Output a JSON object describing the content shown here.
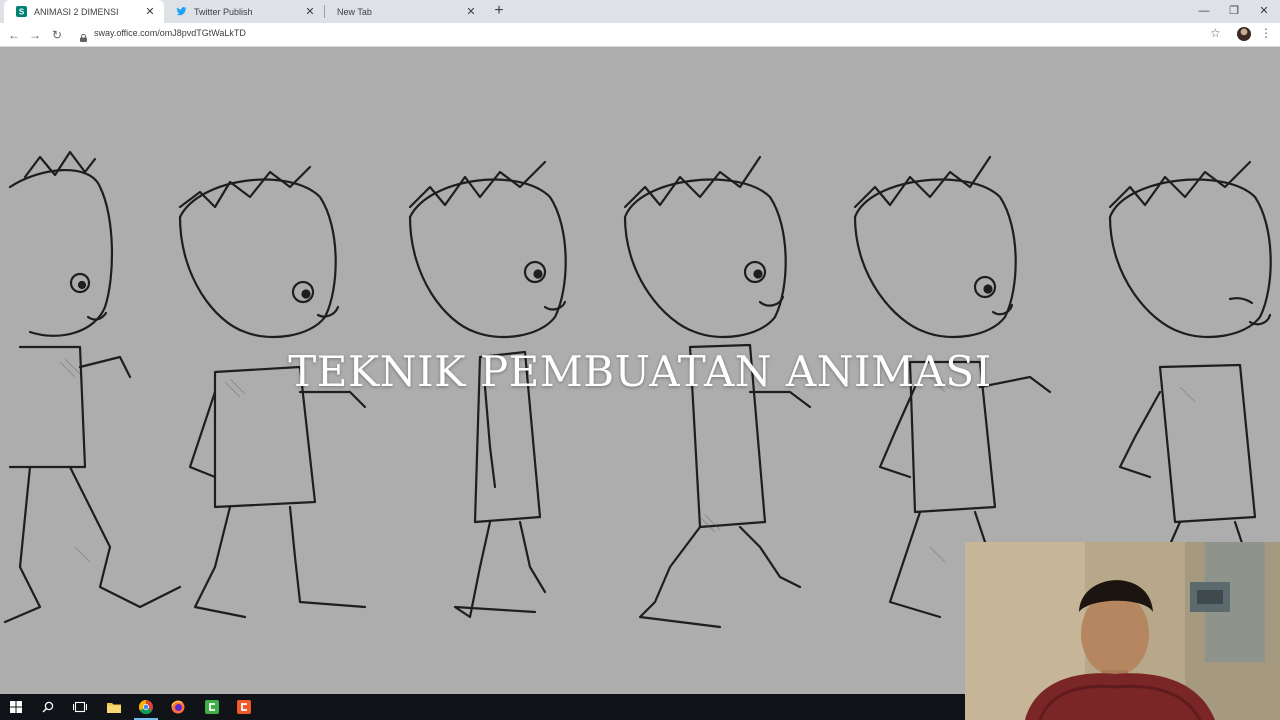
{
  "browser": {
    "tabs": [
      {
        "label": "ANIMASI 2 DIMENSI",
        "icon": "sway-icon",
        "active": true
      },
      {
        "label": "Twitter Publish",
        "icon": "twitter-icon",
        "active": false
      },
      {
        "label": "New Tab",
        "icon": "",
        "active": false
      }
    ],
    "new_tab_glyph": "+",
    "window_controls": {
      "minimize": "—",
      "restore": "❐",
      "close": "✕"
    },
    "nav": {
      "back": "←",
      "forward": "→",
      "reload": "↻"
    },
    "address": "sway.office.com/omJ8pvdTGtWaLkTD",
    "star_glyph": "☆",
    "menu_glyph": "⋮"
  },
  "slide": {
    "title": "TEKNIK PEMBUATAN ANIMASI",
    "background_color": "#adadad",
    "title_color": "#ffffff"
  },
  "taskbar": {
    "items": [
      "windows-start-icon",
      "search-icon",
      "task-view-icon",
      "file-explorer-icon",
      "chrome-icon",
      "firefox-icon",
      "camtasia-icon",
      "camtasia-recorder-icon"
    ],
    "active": "chrome-icon"
  },
  "webcam": {
    "subject": "presenter webcam feed"
  }
}
